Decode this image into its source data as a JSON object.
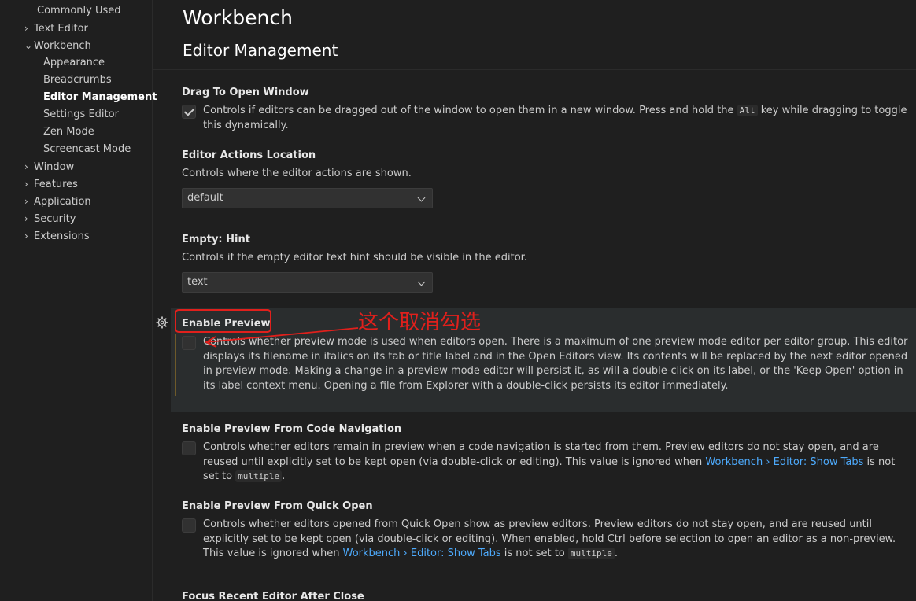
{
  "toc": {
    "items": [
      {
        "label": "Commonly Used",
        "chevron": ""
      },
      {
        "label": "Text Editor",
        "chevron": "›"
      },
      {
        "label": "Workbench",
        "chevron": "⌄"
      },
      {
        "label": "Appearance",
        "chevron": ""
      },
      {
        "label": "Breadcrumbs",
        "chevron": ""
      },
      {
        "label": "Editor Management",
        "chevron": ""
      },
      {
        "label": "Settings Editor",
        "chevron": ""
      },
      {
        "label": "Zen Mode",
        "chevron": ""
      },
      {
        "label": "Screencast Mode",
        "chevron": ""
      },
      {
        "label": "Window",
        "chevron": "›"
      },
      {
        "label": "Features",
        "chevron": "›"
      },
      {
        "label": "Application",
        "chevron": "›"
      },
      {
        "label": "Security",
        "chevron": "›"
      },
      {
        "label": "Extensions",
        "chevron": "›"
      }
    ]
  },
  "header": {
    "title": "Workbench",
    "subtitle": "Editor Management"
  },
  "settings": {
    "drag": {
      "title": "Drag To Open Window",
      "checked": true,
      "desc_a": "Controls if editors can be dragged out of the window to open them in a new window. Press and hold the",
      "key": "Alt",
      "desc_b": "key while dragging to toggle this dynamically."
    },
    "actions": {
      "title": "Editor Actions Location",
      "desc": "Controls where the editor actions are shown.",
      "value": "default"
    },
    "hint": {
      "title_cat": "Empty: ",
      "title_name": "Hint",
      "desc": "Controls if the empty editor text hint should be visible in the editor.",
      "value": "text"
    },
    "preview": {
      "title": "Enable Preview",
      "checked": false,
      "desc": "Controls whether preview mode is used when editors open. There is a maximum of one preview mode editor per editor group. This editor displays its filename in italics on its tab or title label and in the Open Editors view. Its contents will be replaced by the next editor opened in preview mode. Making a change in a preview mode editor will persist it, as will a double-click on its label, or the 'Keep Open' option in its label context menu. Opening a file from Explorer with a double-click persists its editor immediately."
    },
    "preview_code": {
      "title": "Enable Preview From Code Navigation",
      "checked": false,
      "desc_a": "Controls whether editors remain in preview when a code navigation is started from them. Preview editors do not stay open, and are reused until explicitly set to be kept open (via double-click or editing). This value is ignored when ",
      "link": "Workbench › Editor: Show Tabs",
      "desc_b": " is not set to ",
      "code": "multiple",
      "desc_c": "."
    },
    "preview_quick": {
      "title": "Enable Preview From Quick Open",
      "checked": false,
      "desc_a": "Controls whether editors opened from Quick Open show as preview editors. Preview editors do not stay open, and are reused until explicitly set to be kept open (via double-click or editing). When enabled, hold Ctrl before selection to open an editor as a non-preview. This value is ignored when ",
      "link": "Workbench › Editor: Show Tabs",
      "desc_b": " is not set to ",
      "code": "multiple",
      "desc_c": "."
    },
    "focus_recent": {
      "title": "Focus Recent Editor After Close"
    }
  },
  "annotation": {
    "text": "这个取消勾选",
    "color": "#e0201c"
  },
  "colors": {
    "background": "#1f1f1f",
    "focused_row": "#2a2d2e",
    "link": "#4daafc"
  }
}
